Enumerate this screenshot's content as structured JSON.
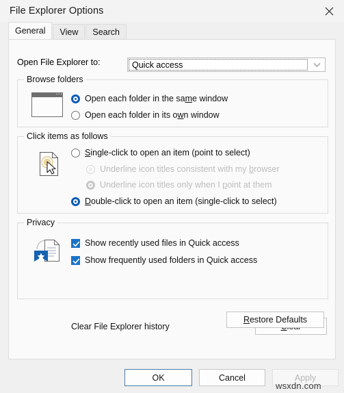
{
  "window": {
    "title": "File Explorer Options",
    "close_icon": "close-icon"
  },
  "tabs": [
    {
      "label": "General",
      "active": true
    },
    {
      "label": "View",
      "active": false
    },
    {
      "label": "Search",
      "active": false
    }
  ],
  "general": {
    "open_to": {
      "label": "Open File Explorer to:",
      "value": "Quick access",
      "arrow_icon": "chevron-down-icon"
    },
    "browse_folders": {
      "legend": "Browse folders",
      "icon": "window-icon",
      "options": [
        {
          "label": "Open each folder in the same window",
          "accel": "m",
          "checked": true
        },
        {
          "label": "Open each folder in its own window",
          "accel": "w",
          "checked": false
        }
      ]
    },
    "click_items": {
      "legend": "Click items as follows",
      "icon": "page-click-icon",
      "options": [
        {
          "label": "Single-click to open an item (point to select)",
          "accel": "S",
          "checked": false,
          "disabled": false
        },
        {
          "label": "Underline icon titles consistent with my browser",
          "accel": "b",
          "checked": false,
          "disabled": true
        },
        {
          "label": "Underline icon titles only when I point at them",
          "accel": "p",
          "checked": true,
          "disabled": true
        },
        {
          "label": "Double-click to open an item (single-click to select)",
          "accel": "D",
          "checked": true,
          "disabled": false
        }
      ]
    },
    "privacy": {
      "legend": "Privacy",
      "icon": "document-star-icon",
      "checkboxes": [
        {
          "label": "Show recently used files in Quick access",
          "checked": true
        },
        {
          "label": "Show frequently used folders in Quick access",
          "checked": true
        }
      ],
      "clear_history_label": "Clear File Explorer history",
      "clear_button": {
        "label": "Clear",
        "accel": "C"
      }
    },
    "restore_button": {
      "label": "Restore Defaults",
      "accel": "R"
    }
  },
  "footer": {
    "ok": {
      "label": "OK",
      "default": true
    },
    "cancel": {
      "label": "Cancel"
    },
    "apply": {
      "label": "Apply",
      "disabled": true
    }
  },
  "watermark": "wsxdn.com",
  "colors": {
    "accent": "#0b5bb5",
    "checkbox": "#1a73c8",
    "dialog_bg": "#f0f0f0",
    "page_bg": "#fafafa",
    "disabled_text": "#bdbdbd"
  }
}
